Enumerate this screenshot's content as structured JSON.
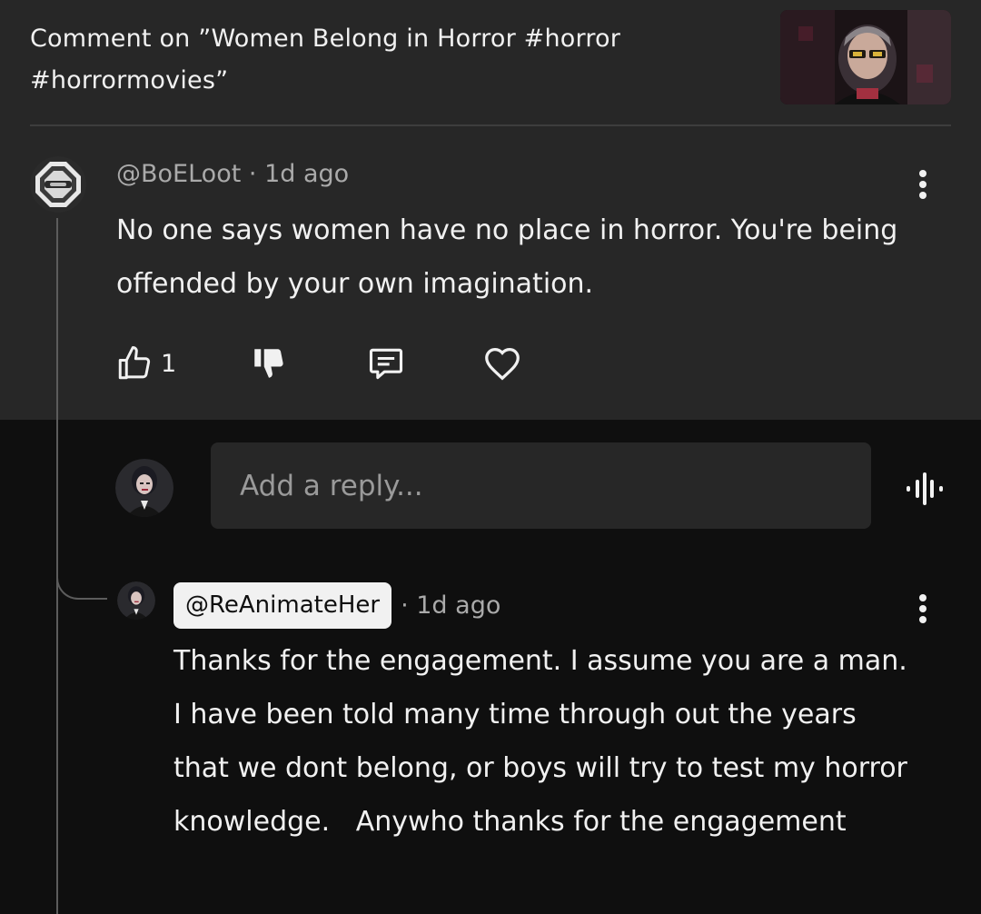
{
  "header": {
    "title": "Comment on ”Women Belong in Horror #horror #horrormovies”",
    "thumbnail_icon": "video-thumbnail"
  },
  "comment": {
    "author": "@BoELoot",
    "separator": "·",
    "time": "1d ago",
    "text": "No one says women have no place in horror. You're being offended by your own imagination.",
    "like_count": "1",
    "icons": {
      "like": "thumb-up-icon",
      "dislike": "thumb-down-icon",
      "reply": "comment-reply-icon",
      "heart": "heart-icon",
      "more": "more-vert-icon"
    }
  },
  "reply_box": {
    "placeholder": "Add a reply...",
    "voice_icon": "voice-wave-icon"
  },
  "reply": {
    "author": "@ReAnimateHer",
    "time": "· 1d ago",
    "text": "Thanks for the engagement. I assume you are a man. I have been told many time through out the years that we dont belong, or boys will try to test my horror knowledge.   Anywho thanks for the engagement"
  },
  "colors": {
    "top_bg": "#272727",
    "bottom_bg": "#0f0f0f",
    "text": "#f1f1f1",
    "secondary_text": "#aaaaaa",
    "author_chip_bg": "#f1f1f1"
  }
}
